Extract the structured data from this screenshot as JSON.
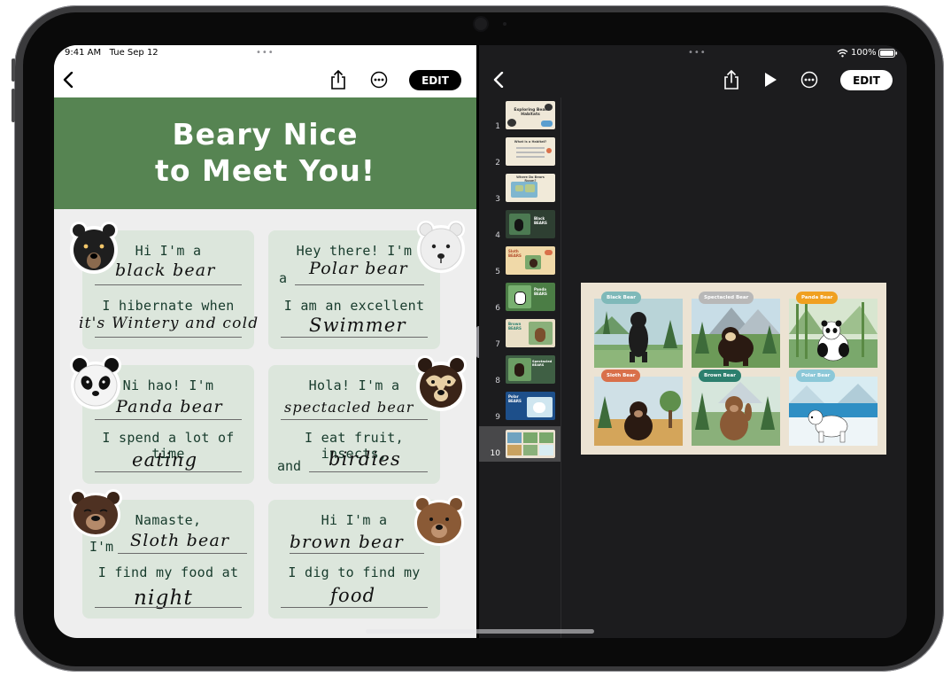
{
  "status_left": {
    "time": "9:41 AM",
    "date": "Tue Sep 12",
    "dots": "•••"
  },
  "status_right": {
    "dots": "•••",
    "battery": "100%"
  },
  "toolbar_left": {
    "edit_label": "EDIT"
  },
  "toolbar_right": {
    "edit_label": "EDIT"
  },
  "banner": {
    "line1": "Beary Nice",
    "line2": "to Meet You!"
  },
  "cards": [
    {
      "line1": "Hi I'm a",
      "answer1": "black bear",
      "line2": "I hibernate when",
      "answer2": "it's Wintery and cold",
      "prefix1": "",
      "prefix2": ""
    },
    {
      "line1": "Hey there! I'm",
      "answer1": "Polar bear",
      "line2": "I am an excellent",
      "answer2": "Swimmer",
      "prefix1": "a",
      "prefix2": ""
    },
    {
      "line1": "Ni hao! I'm",
      "answer1": "Panda bear",
      "line2": "I spend a lot of time",
      "answer2": "eating",
      "prefix1": "",
      "prefix2": ""
    },
    {
      "line1": "Hola! I'm a",
      "answer1": "spectacled bear",
      "line2": "I eat fruit, insects,",
      "answer2": "birdies",
      "prefix1": "",
      "prefix2": "and"
    },
    {
      "line1": "Namaste,",
      "answer1": "Sloth bear",
      "line2": "I find my food at",
      "answer2": "night",
      "prefix1": "I'm",
      "prefix2": ""
    },
    {
      "line1": "Hi I'm a",
      "answer1": "brown bear",
      "line2": "I dig to find my",
      "answer2": "food",
      "prefix1": "",
      "prefix2": ""
    }
  ],
  "slides": [
    {
      "num": "1",
      "title": "Exploring Bear Habitats"
    },
    {
      "num": "2",
      "title": "What is a Habitat?"
    },
    {
      "num": "3",
      "title": "Where Do Bears Roam?"
    },
    {
      "num": "4",
      "title": "Black BEARS"
    },
    {
      "num": "5",
      "title": "Sloth BEARS"
    },
    {
      "num": "6",
      "title": "Panda BEARS"
    },
    {
      "num": "7",
      "title": "Brown BEARS"
    },
    {
      "num": "8",
      "title": "Spectacled BEARS"
    },
    {
      "num": "9",
      "title": "Polar BEARS"
    },
    {
      "num": "10",
      "title": ""
    }
  ],
  "main_slide": {
    "labels": [
      "Black Bear",
      "Spectacled Bear",
      "Panda Bear",
      "Sloth Bear",
      "Brown Bear",
      "Polar Bear"
    ],
    "label_colors": [
      "#7fb9b9",
      "#b8b8b8",
      "#f0a020",
      "#d9704a",
      "#2c7f6e",
      "#8cc8d8"
    ]
  },
  "icons": [
    "back-chevron-icon",
    "share-icon",
    "more-icon",
    "play-icon",
    "wifi-icon",
    "battery-icon"
  ]
}
